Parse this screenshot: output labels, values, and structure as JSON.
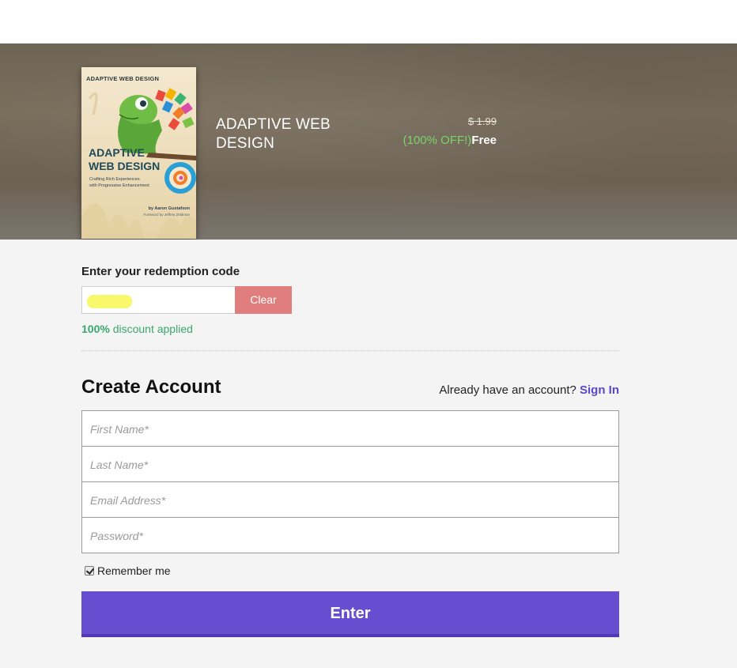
{
  "product": {
    "title": "ADAPTIVE WEB DESIGN",
    "price_original": "$ 1.99",
    "discount_label": "(100% OFF!)",
    "price_final": "Free",
    "cover": {
      "series": "ADAPTIVE WEB DESIGN",
      "title_line1": "ADAPTIVE",
      "title_line2": "WEB DESIGN",
      "subtitle_line1": "Crafting Rich Experiences",
      "subtitle_line2": "with Progressive Enhancement",
      "author": "by Aaron Gustafson",
      "foreword": "Foreword by Jeffrey Zeldman"
    }
  },
  "redemption": {
    "label": "Enter your redemption code",
    "code_value": "",
    "clear_label": "Clear",
    "discount_percent": "100%",
    "discount_text": " discount applied"
  },
  "account": {
    "title": "Create Account",
    "signin_prompt": "Already have an account? ",
    "signin_link": "Sign In",
    "fields": {
      "first_name": "First Name*",
      "last_name": "Last Name*",
      "email": "Email Address*",
      "password": "Password*"
    },
    "remember_label": "Remember me",
    "remember_checked": true,
    "submit_label": "Enter"
  },
  "colors": {
    "accent": "#674ed0",
    "link": "#5b48c8",
    "clear_button": "#e07e7e",
    "success": "#3aa76d",
    "discount_green": "#7cd36a"
  }
}
